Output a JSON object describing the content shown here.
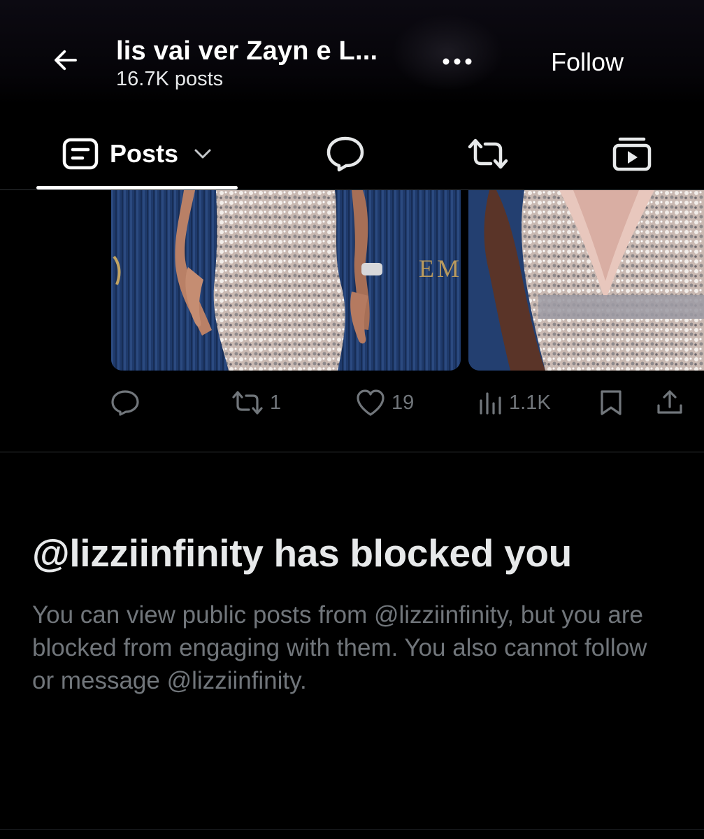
{
  "header": {
    "title": "lis vai ver Zayn e L...",
    "post_count": "16.7K posts",
    "follow_label": "Follow",
    "back_icon": "arrow-left-icon",
    "more_icon": "more-horizontal-icon"
  },
  "tabs": [
    {
      "label": "Posts",
      "icon": "posts-icon",
      "active": true,
      "has_dropdown": true
    },
    {
      "label": "",
      "icon": "reply-bubble-icon"
    },
    {
      "label": "",
      "icon": "repost-icon"
    },
    {
      "label": "",
      "icon": "media-icon"
    }
  ],
  "post": {
    "photo_sign_text": "EM",
    "actions": {
      "reply": {
        "icon": "reply-icon",
        "count": ""
      },
      "repost": {
        "icon": "repost-icon",
        "count": "1"
      },
      "like": {
        "icon": "heart-icon",
        "count": "19"
      },
      "views": {
        "icon": "views-chart-icon",
        "count": "1.1K"
      },
      "bookmark": {
        "icon": "bookmark-icon"
      },
      "share": {
        "icon": "share-icon"
      }
    }
  },
  "block_notice": {
    "title": "@lizziinfinity has blocked you",
    "body": "You can view public posts from @lizziinfinity, but you are blocked from engaging with them. You also cannot follow or message @lizziinfinity."
  },
  "colors": {
    "background": "#000000",
    "primary_text": "#e7e9ea",
    "secondary_text": "#71767b",
    "divider": "#2f3336",
    "photo_backdrop": "#1e3766"
  }
}
